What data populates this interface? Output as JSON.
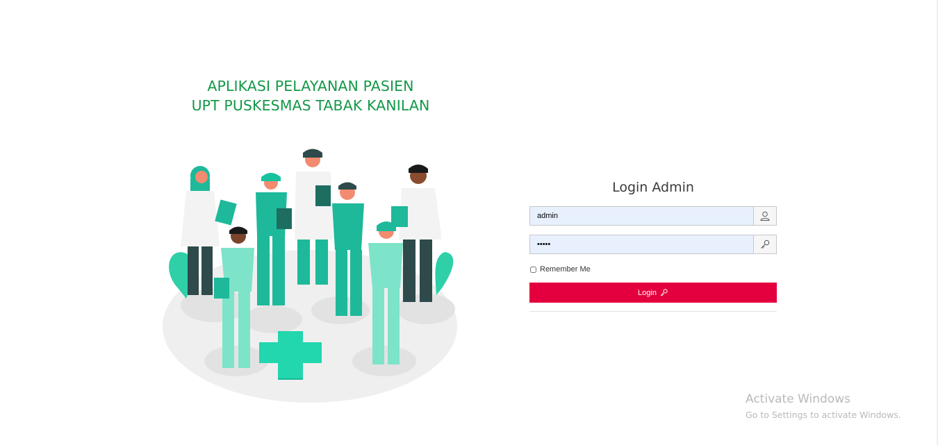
{
  "app": {
    "title_line1": "APLIKASI PELAYANAN PASIEN",
    "title_line2": "UPT PUSKESMAS TABAK KANILAN"
  },
  "illustration": {
    "description_icon": "medical-team-illustration",
    "colors": {
      "teal": "#1db99a",
      "mint": "#7de3c9",
      "cross": "#17c29f",
      "shadow": "#e4e4e4"
    }
  },
  "login": {
    "heading": "Login Admin",
    "username_value": "admin",
    "username_icon": "user-icon",
    "password_value": "•••••",
    "password_icon": "key-icon",
    "remember_label": "Remember Me",
    "remember_checked": false,
    "button_label": "Login",
    "button_icon": "key-icon",
    "button_color": "#e4003f"
  },
  "watermark": {
    "title": "Activate Windows",
    "subtitle": "Go to Settings to activate Windows."
  }
}
